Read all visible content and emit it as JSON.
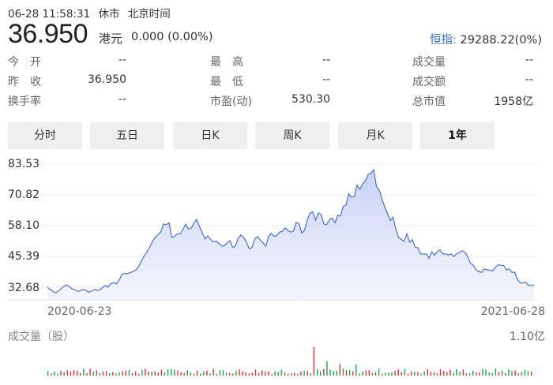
{
  "header": {
    "datetime": "06-28 11:58:31",
    "market_status": "休市",
    "timezone": "北京时间",
    "price": "36.950",
    "currency": "港元",
    "change": "0.000 (0.00%)",
    "index_label": "恒指:",
    "index_value": "29288.22(0%)"
  },
  "stats": {
    "row1": [
      {
        "label": "今　开",
        "value": "--"
      },
      {
        "label": "最　高",
        "value": "--"
      },
      {
        "label": "成交量",
        "value": "--"
      }
    ],
    "row2": [
      {
        "label": "昨　收",
        "value": "36.950"
      },
      {
        "label": "最　低",
        "value": "--"
      },
      {
        "label": "成交额",
        "value": "--"
      }
    ],
    "row3": [
      {
        "label": "换手率",
        "value": "--"
      },
      {
        "label": "市盈(动)",
        "value": "530.30"
      },
      {
        "label": "总市值",
        "value": "1958亿"
      }
    ]
  },
  "tabs": [
    {
      "label": "分时"
    },
    {
      "label": "五日"
    },
    {
      "label": "日K"
    },
    {
      "label": "周K"
    },
    {
      "label": "月K"
    },
    {
      "label": "1年",
      "active": true
    }
  ],
  "chart_data": {
    "type": "area",
    "y_ticks": [
      "83.53",
      "70.82",
      "58.10",
      "45.39",
      "32.68"
    ],
    "x_ticks": [
      "2020-06-23",
      "2021-06-28"
    ],
    "ylim": [
      32.68,
      83.53
    ],
    "line_color": "#4a6fd8",
    "x_start": "2020-06-23",
    "x_end": "2021-06-28",
    "series": [
      {
        "values": [
          33.2,
          32.5,
          31.6,
          31.0,
          31.8,
          32.7,
          33.8,
          34.2,
          33.5,
          32.6,
          32.2,
          31.6,
          31.9,
          32.4,
          32.0,
          31.3,
          31.7,
          32.4,
          31.9,
          32.3,
          33.2,
          34.0,
          33.4,
          34.8,
          35.2,
          34.6,
          36.3,
          38.6,
          38.9,
          38.8,
          39.3,
          39.7,
          40.4,
          41.7,
          44.0,
          46.1,
          47.7,
          49.6,
          52.0,
          53.7,
          54.7,
          55.9,
          59.0,
          58.8,
          59.6,
          53.6,
          54.1,
          55.0,
          55.1,
          56.8,
          59.0,
          57.1,
          57.4,
          59.5,
          60.9,
          58.1,
          55.6,
          53.0,
          54.2,
          52.8,
          51.8,
          52.1,
          51.2,
          50.1,
          50.3,
          51.4,
          52.3,
          49.5,
          50.2,
          53.2,
          54.6,
          53.5,
          51.6,
          49.0,
          49.6,
          53.1,
          54.0,
          52.5,
          51.4,
          50.1,
          54.0,
          55.3,
          54.0,
          54.5,
          55.8,
          56.1,
          57.5,
          56.5,
          55.8,
          56.2,
          59.7,
          59.2,
          55.4,
          56.5,
          60.8,
          63.6,
          64.0,
          60.6,
          63.6,
          62.9,
          59.1,
          58.8,
          60.8,
          61.5,
          59.6,
          62.6,
          62.4,
          66.3,
          66.8,
          71.4,
          70.1,
          70.3,
          74.9,
          73.3,
          75.4,
          76.7,
          79.3,
          79.8,
          81.2,
          74.4,
          73.1,
          69.3,
          66.0,
          63.4,
          60.5,
          61.9,
          57.1,
          53.5,
          52.8,
          52.1,
          55.1,
          51.7,
          52.7,
          49.6,
          49.4,
          46.9,
          46.8,
          46.9,
          45.1,
          47.7,
          46.4,
          47.8,
          48.5,
          46.9,
          46.9,
          46.5,
          46.8,
          45.8,
          47.0,
          47.5,
          48.2,
          47.6,
          45.7,
          43.0,
          42.3,
          40.4,
          39.8,
          39.3,
          40.8,
          40.4,
          40.2,
          40.0,
          41.4,
          42.4,
          42.3,
          42.2,
          40.4,
          40.8,
          39.4,
          39.4,
          36.5,
          35.1,
          35.0,
          35.4,
          34.0,
          34.2,
          34.1
        ]
      }
    ]
  },
  "volume": {
    "label": "成交量（股）",
    "max_label": "1.10亿",
    "up_color": "#1aa34a",
    "down_color": "#e0303a"
  }
}
